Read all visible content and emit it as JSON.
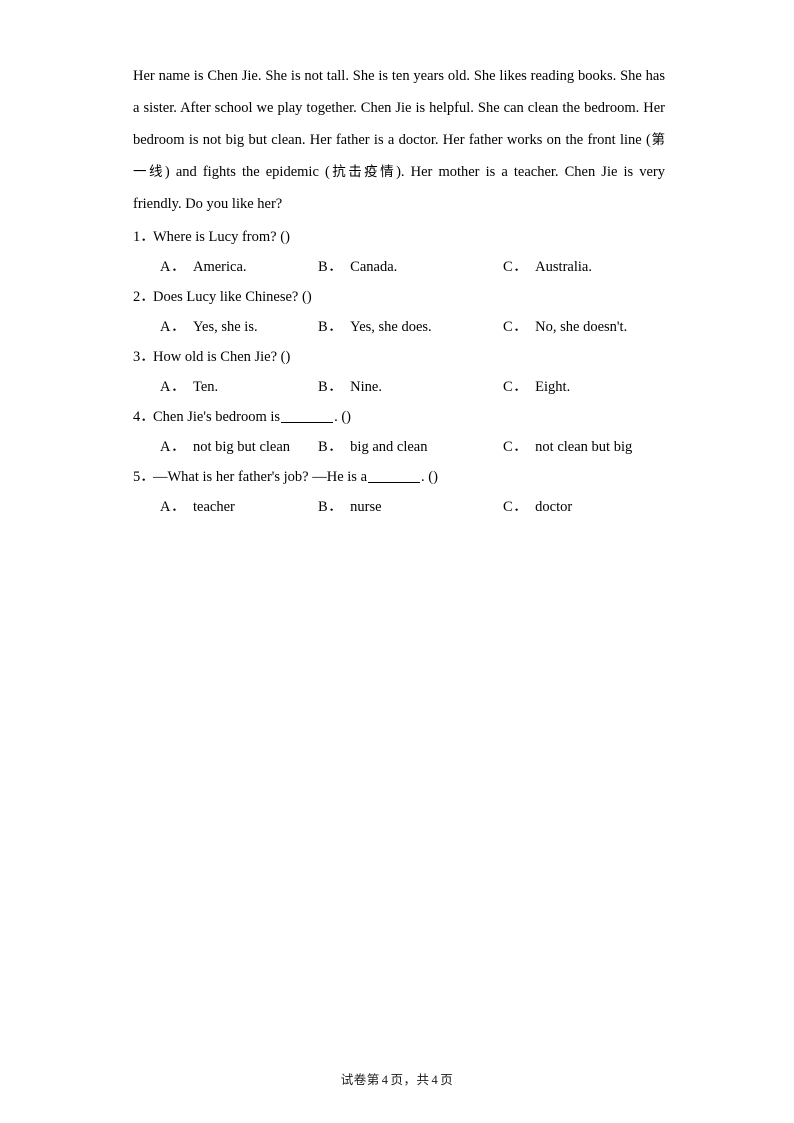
{
  "passage": {
    "text_before_cn1": "Her name is Chen Jie. She is not tall. She is ten years old. She likes reading books. She has a sister. After school we play together. Chen Jie is helpful. She can clean the bedroom. Her bedroom is not big but clean. Her father is a doctor. Her father works on the front line (",
    "cn1": "第一线",
    "text_between": ") and fights the epidemic (",
    "cn2": "抗击疫情",
    "text_after": "). Her mother is a teacher. Chen Jie is very friendly. Do you like her?"
  },
  "questions": [
    {
      "number": "1．",
      "stem_before": "Where is Lucy from? (",
      "has_blank": false,
      "stem_after": "",
      "paren_close": ")",
      "options": [
        {
          "letter": "A．",
          "text": "America."
        },
        {
          "letter": "B．",
          "text": "Canada."
        },
        {
          "letter": "C．",
          "text": "Australia."
        }
      ]
    },
    {
      "number": "2．",
      "stem_before": "Does Lucy like Chinese? (",
      "has_blank": false,
      "stem_after": "",
      "paren_close": ")",
      "options": [
        {
          "letter": "A．",
          "text": "Yes, she is."
        },
        {
          "letter": "B．",
          "text": "Yes, she does."
        },
        {
          "letter": "C．",
          "text": "No, she doesn't."
        }
      ]
    },
    {
      "number": "3．",
      "stem_before": "How old is Chen Jie? (",
      "has_blank": false,
      "stem_after": "",
      "paren_close": ")",
      "options": [
        {
          "letter": "A．",
          "text": "Ten."
        },
        {
          "letter": "B．",
          "text": "Nine."
        },
        {
          "letter": "C．",
          "text": "Eight."
        }
      ]
    },
    {
      "number": "4．",
      "stem_before": "Chen Jie's bedroom is ",
      "has_blank": true,
      "stem_after": ". (",
      "paren_close": ")",
      "options": [
        {
          "letter": "A．",
          "text": "not big but clean"
        },
        {
          "letter": "B．",
          "text": "big and clean"
        },
        {
          "letter": "C．",
          "text": "not clean but big"
        }
      ]
    },
    {
      "number": "5．",
      "stem_before": "—What is her father's job? —He is a ",
      "has_blank": true,
      "stem_after": ". (",
      "paren_close": ")",
      "options": [
        {
          "letter": "A．",
          "text": "teacher"
        },
        {
          "letter": "B．",
          "text": "nurse"
        },
        {
          "letter": "C．",
          "text": "doctor"
        }
      ]
    }
  ],
  "footer": {
    "prefix": "试卷第",
    "current_page": "4",
    "middle": "页，共",
    "total_pages": "4",
    "suffix": "页"
  }
}
